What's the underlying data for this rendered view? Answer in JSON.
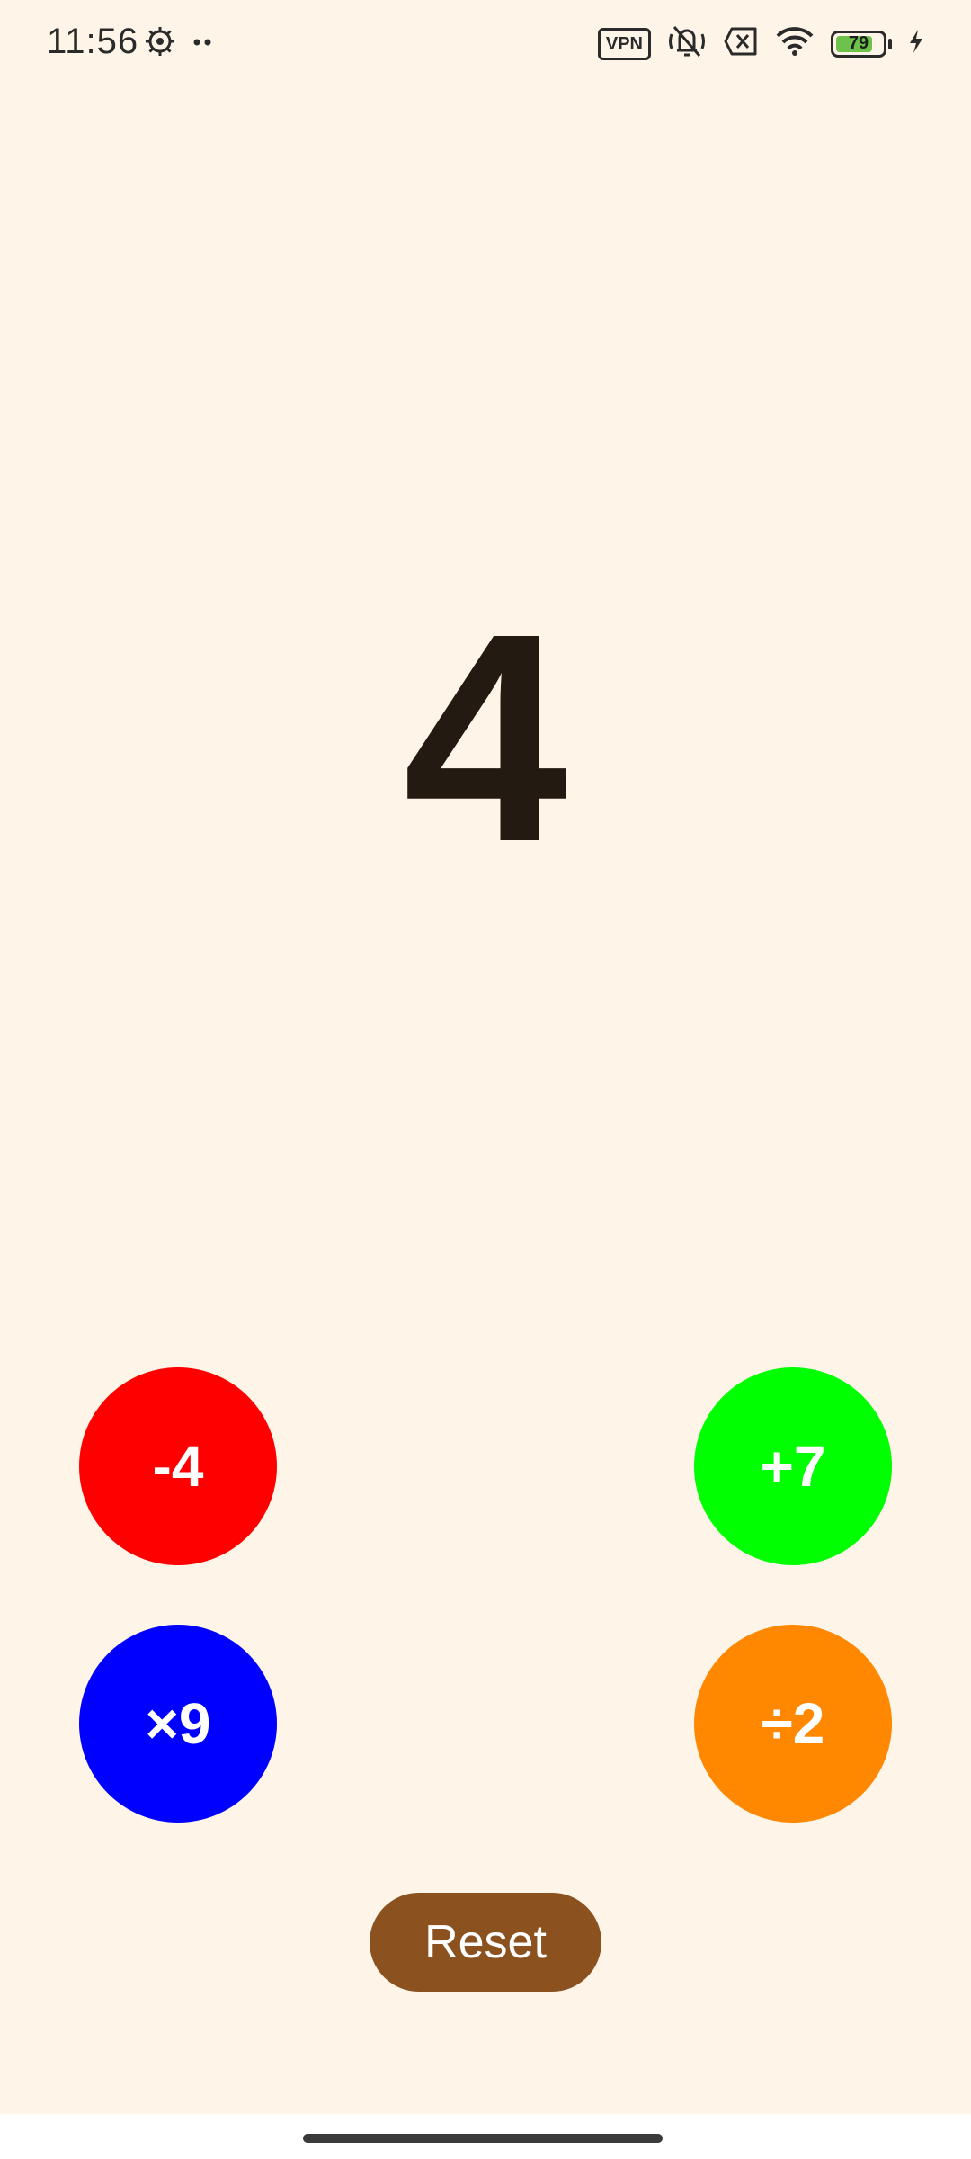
{
  "status_bar": {
    "time": "11:56",
    "left_icons": [
      "settings-gear-icon",
      "more-dots-icon"
    ],
    "vpn_label": "VPN",
    "battery_level": "79",
    "battery_fraction": 0.79
  },
  "counter": {
    "value": "4"
  },
  "buttons": {
    "minus": {
      "label": "-4",
      "color": "#FF0000"
    },
    "plus": {
      "label": "+7",
      "color": "#00FF00"
    },
    "multiply": {
      "label": "×9",
      "color": "#0000FF"
    },
    "divide": {
      "label": "÷2",
      "color": "#FF8800"
    },
    "reset": {
      "label": "Reset",
      "color": "#8B5220"
    }
  },
  "colors": {
    "background": "#FEF4E8",
    "counter_text": "#231A12"
  }
}
